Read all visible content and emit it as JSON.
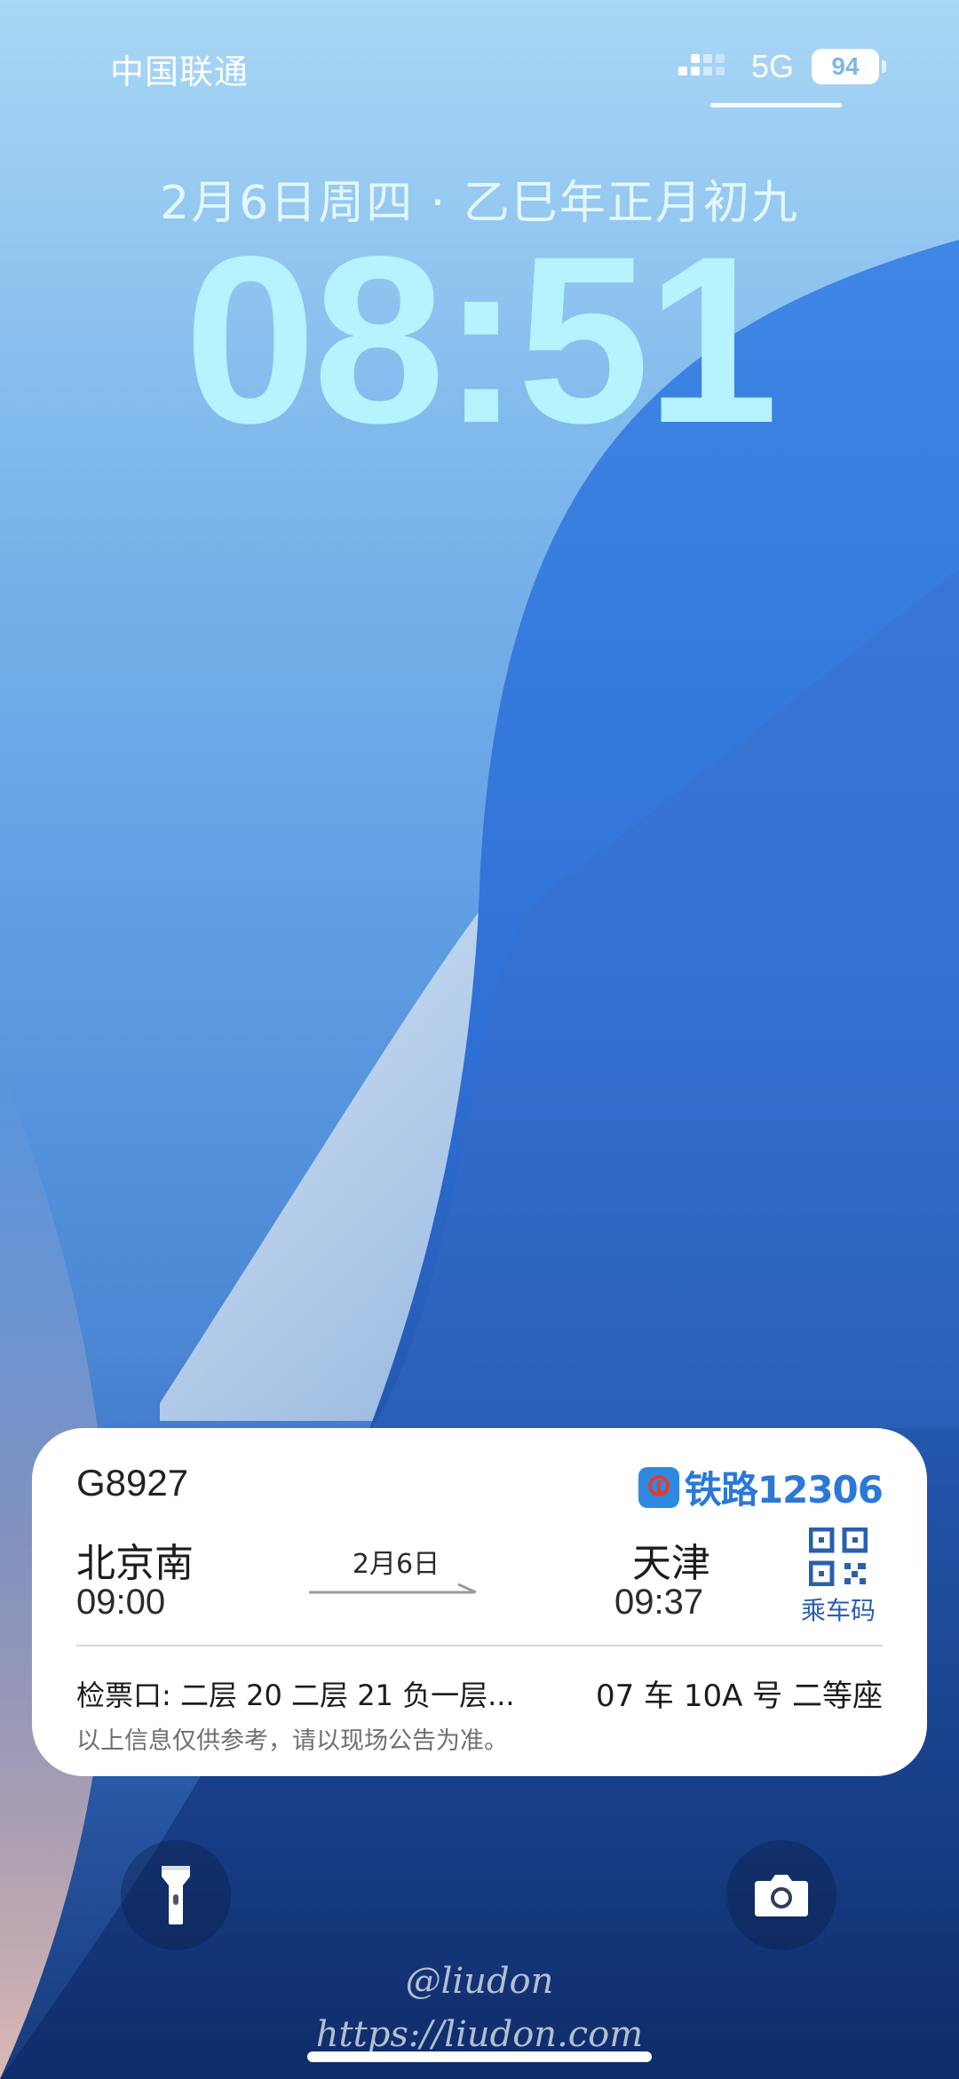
{
  "status_bar": {
    "carrier": "中国联通",
    "network": "5G",
    "battery": "94",
    "signal_icon": "signal-bars-icon"
  },
  "lock_screen": {
    "date": "2月6日周四 · 乙巳年正月初九",
    "time": "08:51"
  },
  "train_widget": {
    "train_number": "G8927",
    "brand": "铁路12306",
    "brand_icon": "railway-logo-icon",
    "departure_station": "北京南",
    "departure_time": "09:00",
    "travel_date": "2月6日",
    "arrival_station": "天津",
    "arrival_time": "09:37",
    "qr_label": "乘车码",
    "qr_icon": "qr-code-icon",
    "gate": "检票口: 二层 20 二层 21 负一层...",
    "seat": "07 车 10A 号 二等座",
    "disclaimer": "以上信息仅供参考，请以现场公告为准。"
  },
  "controls": {
    "flashlight_icon": "flashlight-icon",
    "camera_icon": "camera-icon"
  },
  "watermark": {
    "handle": "@liudon",
    "url": "https://liudon.com"
  },
  "colors": {
    "clock": "#b4f3ff",
    "brand": "#2a78d8",
    "card_bg": "#ffffff"
  }
}
